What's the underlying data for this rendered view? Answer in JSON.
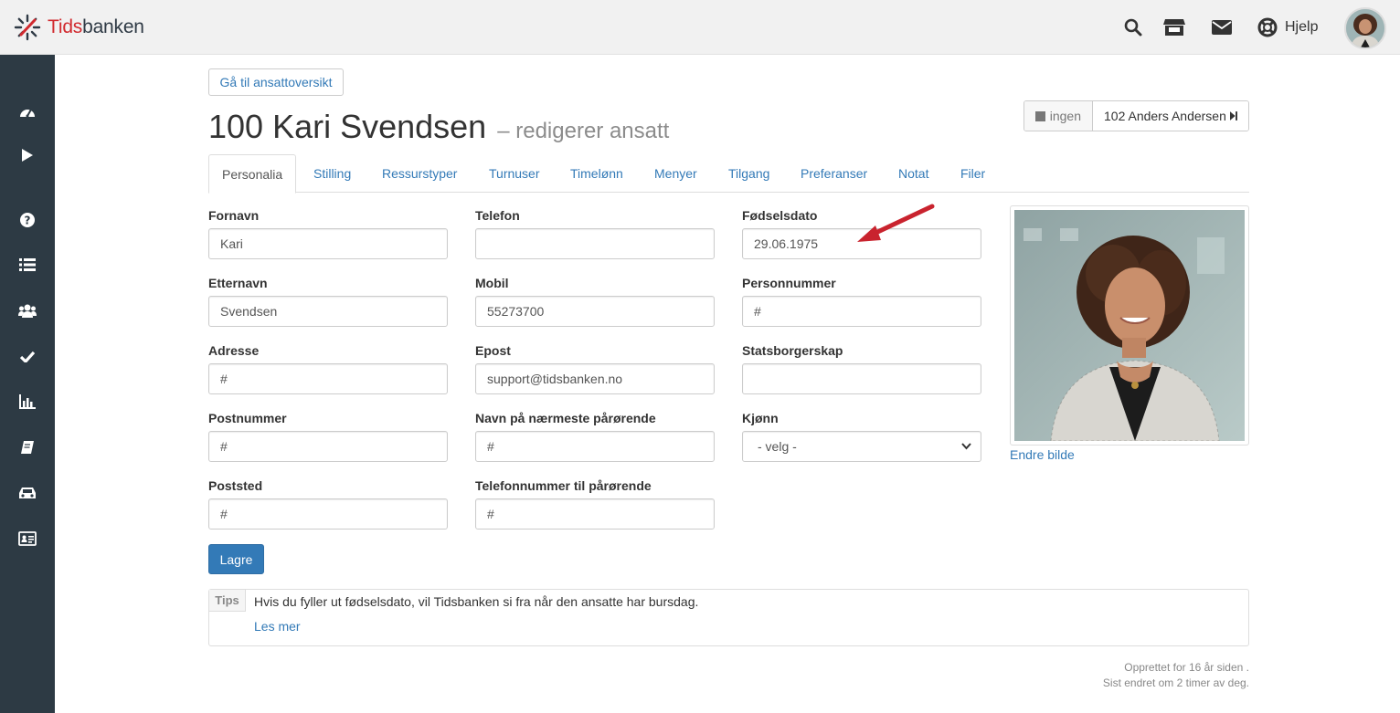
{
  "brand": {
    "logo_text_red": "Tids",
    "logo_text_dark": "banken"
  },
  "topbar": {
    "icons": [
      "search-icon",
      "store-icon",
      "envelope-icon",
      "life-ring-icon"
    ],
    "help_label": "Hjelp"
  },
  "sidebar": {
    "icons": [
      "dashboard-icon",
      "play-icon",
      "question-icon",
      "list-icon",
      "users-icon",
      "check-icon",
      "bar-chart-icon",
      "book-icon",
      "car-icon",
      "id-card-icon"
    ]
  },
  "header": {
    "back_button": "Gå til ansattoversikt",
    "title": "100 Kari Svendsen",
    "subtitle": "– redigerer ansatt",
    "prev_label": "ingen",
    "next_label": "102 Anders Andersen"
  },
  "tabs": [
    "Personalia",
    "Stilling",
    "Ressurstyper",
    "Turnuser",
    "Timelønn",
    "Menyer",
    "Tilgang",
    "Preferanser",
    "Notat",
    "Filer"
  ],
  "form": {
    "fornavn": {
      "label": "Fornavn",
      "value": "Kari"
    },
    "etternavn": {
      "label": "Etternavn",
      "value": "Svendsen"
    },
    "adresse": {
      "label": "Adresse",
      "value": "#"
    },
    "postnummer": {
      "label": "Postnummer",
      "value": "#"
    },
    "poststed": {
      "label": "Poststed",
      "value": "#"
    },
    "telefon": {
      "label": "Telefon",
      "value": ""
    },
    "mobil": {
      "label": "Mobil",
      "value": "55273700"
    },
    "epost": {
      "label": "Epost",
      "value": "support@tidsbanken.no"
    },
    "parorende_navn": {
      "label": "Navn på nærmeste pårørende",
      "value": "#"
    },
    "parorende_tlf": {
      "label": "Telefonnummer til pårørende",
      "value": "#"
    },
    "fodselsdato": {
      "label": "Fødselsdato",
      "value": "29.06.1975"
    },
    "personnummer": {
      "label": "Personnummer",
      "value": "#"
    },
    "statsborgerskap": {
      "label": "Statsborgerskap",
      "value": ""
    },
    "kjonn": {
      "label": "Kjønn",
      "value": "- velg -"
    },
    "save_label": "Lagre"
  },
  "photo": {
    "change_label": "Endre bilde"
  },
  "tips": {
    "tag": "Tips",
    "text": "Hvis du fyller ut fødselsdato, vil Tidsbanken si fra når den ansatte har bursdag.",
    "link": "Les mer"
  },
  "meta": {
    "created": "Opprettet for 16 år siden .",
    "modified": "Sist endret om 2 timer av deg."
  },
  "colors": {
    "sidebar": "#2d3a44",
    "topbar": "#f1f1f1",
    "link": "#337ab7",
    "primary": "#337ab7",
    "brand_red": "#d12a2f",
    "arrow": "#c9232e"
  }
}
